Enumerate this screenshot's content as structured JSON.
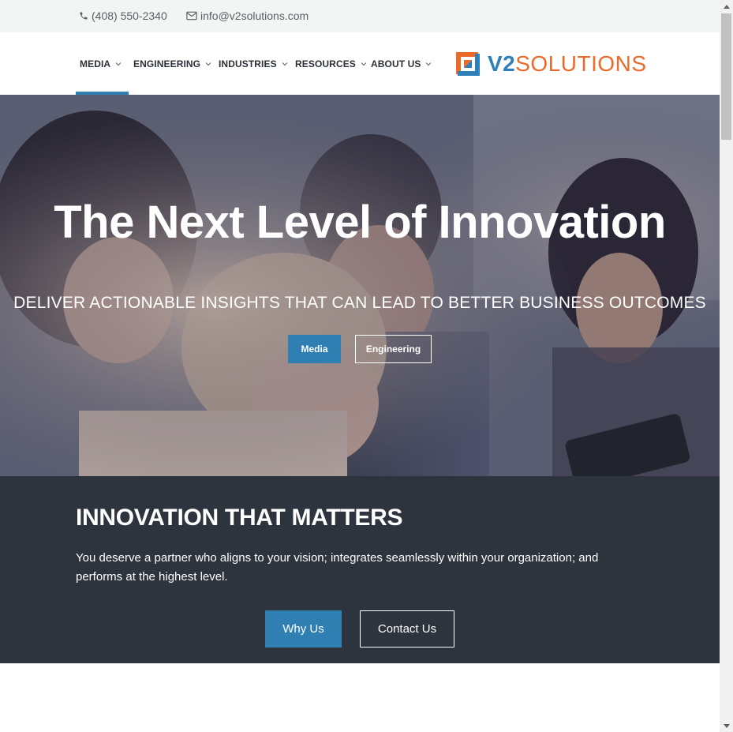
{
  "topbar": {
    "phone": "(408) 550-2340",
    "email": "info@v2solutions.com",
    "phone_icon": "phone-icon",
    "email_icon": "envelope-icon"
  },
  "nav": {
    "items": [
      {
        "label": "MEDIA",
        "active": true
      },
      {
        "label": "ENGINEERING",
        "active": false
      },
      {
        "label": "INDUSTRIES",
        "active": false
      },
      {
        "label": "RESOURCES",
        "active": false
      },
      {
        "label": "ABOUT US",
        "active": false
      }
    ],
    "chevron_icon": "chevron-down-icon"
  },
  "logo": {
    "brand_v2": "V2",
    "brand_rest": "SOLUTIONS"
  },
  "hero": {
    "title": "The Next Level of Innovation",
    "subtitle": "DELIVER ACTIONABLE INSIGHTS THAT CAN LEAD TO BETTER BUSINESS OUTCOMES",
    "primary_button": "Media",
    "secondary_button": "Engineering"
  },
  "band": {
    "title": "INNOVATION THAT MATTERS",
    "text": "You deserve a partner who aligns to your vision; integrates seamlessly within your organization; and performs at the highest level.",
    "primary_button": "Why Us",
    "secondary_button": "Contact Us"
  },
  "colors": {
    "accent_blue": "#2f7fb3",
    "brand_orange": "#ea6a2c",
    "dark_band": "#2e343d",
    "nav_text": "#2b3038"
  }
}
